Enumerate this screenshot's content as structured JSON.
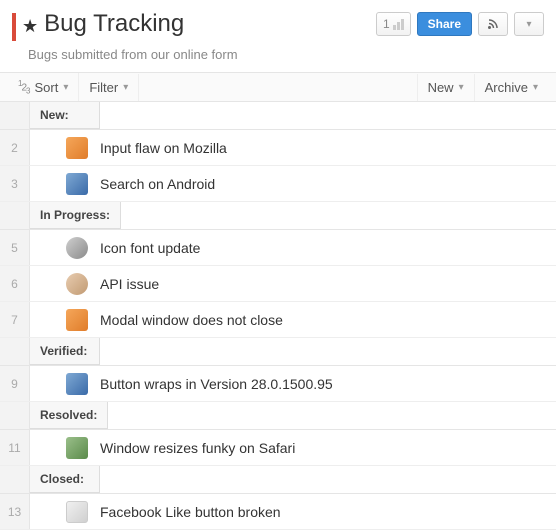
{
  "header": {
    "title": "Bug Tracking",
    "subtitle": "Bugs submitted from our online form",
    "count": "1",
    "share_label": "Share"
  },
  "toolbar": {
    "sort_label": "Sort",
    "filter_label": "Filter",
    "new_label": "New",
    "archive_label": "Archive"
  },
  "groups": [
    {
      "label": "New:",
      "rows": [
        {
          "num": "2",
          "avatar": "av-orange",
          "title": "Input flaw on Mozilla"
        },
        {
          "num": "3",
          "avatar": "av-blue",
          "title": "Search on Android"
        }
      ]
    },
    {
      "label": "In Progress:",
      "rows": [
        {
          "num": "5",
          "avatar": "av-gray",
          "title": "Icon font update"
        },
        {
          "num": "6",
          "avatar": "av-tan",
          "title": "API issue"
        },
        {
          "num": "7",
          "avatar": "av-orange",
          "title": "Modal window does not close"
        }
      ]
    },
    {
      "label": "Verified:",
      "rows": [
        {
          "num": "9",
          "avatar": "av-blue",
          "title": "Button wraps in Version 28.0.1500.95"
        }
      ]
    },
    {
      "label": "Resolved:",
      "rows": [
        {
          "num": "11",
          "avatar": "av-green",
          "title": "Window resizes funky on Safari"
        }
      ]
    },
    {
      "label": "Closed:",
      "rows": [
        {
          "num": "13",
          "avatar": "av-white",
          "title": "Facebook Like button broken"
        }
      ]
    }
  ]
}
